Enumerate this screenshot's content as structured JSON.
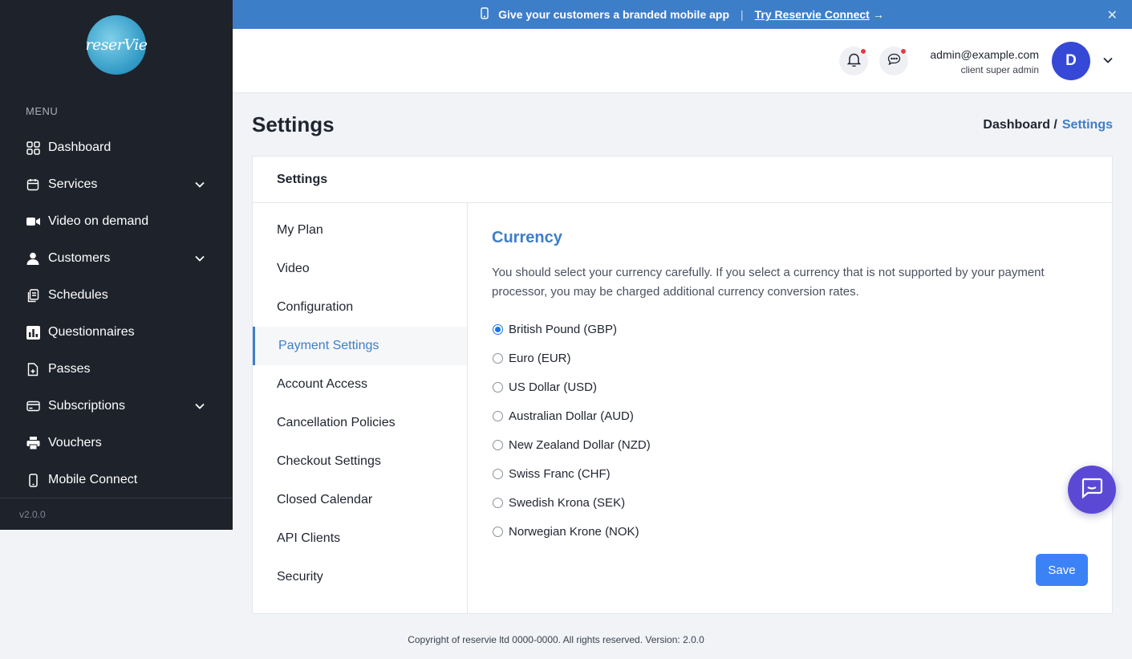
{
  "sidebar": {
    "logo_text": "reserVie",
    "menu_label": "MENU",
    "items": [
      {
        "label": "Dashboard",
        "icon": "grid-icon",
        "has_children": false
      },
      {
        "label": "Services",
        "icon": "calendar-icon",
        "has_children": true
      },
      {
        "label": "Video on demand",
        "icon": "video-icon",
        "has_children": false
      },
      {
        "label": "Customers",
        "icon": "user-icon",
        "has_children": true
      },
      {
        "label": "Schedules",
        "icon": "clipboard-icon",
        "has_children": false
      },
      {
        "label": "Questionnaires",
        "icon": "bar-chart-icon",
        "has_children": false
      },
      {
        "label": "Passes",
        "icon": "file-icon",
        "has_children": false
      },
      {
        "label": "Subscriptions",
        "icon": "credit-card-icon",
        "has_children": true
      },
      {
        "label": "Vouchers",
        "icon": "printer-icon",
        "has_children": false
      },
      {
        "label": "Mobile Connect",
        "icon": "mobile-icon",
        "has_children": false
      }
    ],
    "version": "v2.0.0"
  },
  "banner": {
    "text": "Give your customers a branded mobile app",
    "separator": "|",
    "link_text": "Try Reservie Connect",
    "arrow": "→",
    "close": "✕"
  },
  "header": {
    "email": "admin@example.com",
    "role": "client super admin",
    "avatar_initial": "D"
  },
  "page": {
    "title": "Settings",
    "breadcrumb": [
      "Dashboard /",
      "Settings"
    ]
  },
  "card": {
    "title": "Settings",
    "subnav": [
      {
        "label": "My Plan",
        "active": false
      },
      {
        "label": "Video",
        "active": false
      },
      {
        "label": "Configuration",
        "active": false
      },
      {
        "label": "Payment Settings",
        "active": true
      },
      {
        "label": "Account Access",
        "active": false
      },
      {
        "label": "Cancellation Policies",
        "active": false
      },
      {
        "label": "Checkout Settings",
        "active": false
      },
      {
        "label": "Closed Calendar",
        "active": false
      },
      {
        "label": "API Clients",
        "active": false
      },
      {
        "label": "Security",
        "active": false
      }
    ]
  },
  "currency": {
    "title": "Currency",
    "description": "You should select your currency carefully. If you select a currency that is not supported by your payment processor, you may be charged additional currency conversion rates.",
    "options": [
      {
        "label": "British Pound (GBP)",
        "checked": true
      },
      {
        "label": "Euro (EUR)",
        "checked": false
      },
      {
        "label": "US Dollar (USD)",
        "checked": false
      },
      {
        "label": "Australian Dollar (AUD)",
        "checked": false
      },
      {
        "label": "New Zealand Dollar (NZD)",
        "checked": false
      },
      {
        "label": "Swiss Franc (CHF)",
        "checked": false
      },
      {
        "label": "Swedish Krona (SEK)",
        "checked": false
      },
      {
        "label": "Norwegian Krone (NOK)",
        "checked": false
      }
    ],
    "save_label": "Save"
  },
  "footer": {
    "text": "Copyright of reservie ltd 0000-0000. All rights reserved. Version: 2.0.0"
  },
  "colors": {
    "sidebar_bg": "#1e222b",
    "banner_bg": "#3d7ec9",
    "accent": "#3d7ec9",
    "save_button": "#3b82f6",
    "chat_fab": "#5b49d6",
    "notification_dot": "#e53945"
  }
}
